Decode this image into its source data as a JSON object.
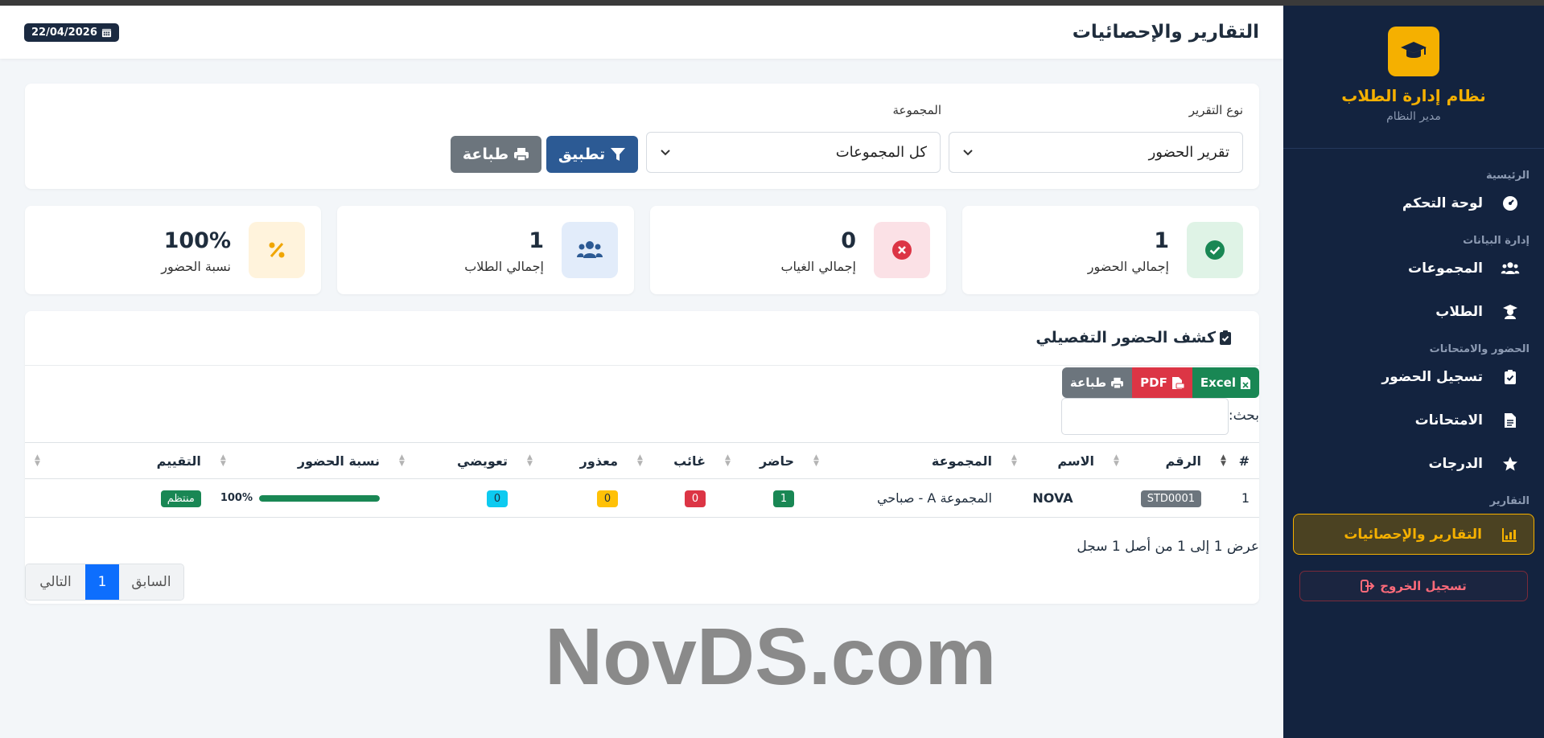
{
  "header": {
    "title": "التقارير والإحصائيات",
    "date": "22/04/2026"
  },
  "sidebar": {
    "brand_title": "نظام إدارة الطلاب",
    "brand_sub": "مدير النظام",
    "sections": {
      "main": "الرئيسية",
      "data": "إدارة البيانات",
      "attendance": "الحضور والامتحانات",
      "reports": "التقارير"
    },
    "items": {
      "dashboard": "لوحة التحكم",
      "groups": "المجموعات",
      "students": "الطلاب",
      "attendance": "تسجيل الحضور",
      "exams": "الامتحانات",
      "grades": "الدرجات",
      "reports": "التقارير والإحصائيات"
    },
    "logout": "تسجيل الخروج"
  },
  "filter": {
    "report_type_label": "نوع التقرير",
    "report_type_value": "تقرير الحضور",
    "group_label": "المجموعة",
    "group_value": "كل المجموعات",
    "apply": "تطبيق",
    "print": "طباعة"
  },
  "stats": [
    {
      "value": "1",
      "label": "إجمالي الحضور"
    },
    {
      "value": "0",
      "label": "إجمالي الغياب"
    },
    {
      "value": "1",
      "label": "إجمالي الطلاب"
    },
    {
      "value": "100%",
      "label": "نسبة الحضور"
    }
  ],
  "table_card": {
    "title": "كشف الحضور التفصيلي",
    "export": {
      "excel": "Excel",
      "pdf": "PDF",
      "print": "طباعة"
    },
    "search_label": "بحث:",
    "columns": [
      "#",
      "الرقم",
      "الاسم",
      "المجموعة",
      "حاضر",
      "غائب",
      "معذور",
      "تعويضي",
      "نسبة الحضور",
      "التقييم"
    ],
    "rows": [
      {
        "num": "1",
        "id": "STD0001",
        "name": "NOVA",
        "group": "المجموعة A - صباحي",
        "present": "1",
        "absent": "0",
        "excused": "0",
        "makeup": "0",
        "rate": "100%",
        "rate_fraction": 1.0,
        "grade": "منتظم"
      }
    ],
    "info": "عرض 1 إلى 1 من أصل 1 سجل",
    "pager": {
      "prev": "السابق",
      "page": "1",
      "next": "التالي"
    }
  },
  "watermark": "NovDS.com",
  "colors": {
    "sidebar_bg": "#13233f",
    "accent": "#f5b000",
    "primary": "#2c5a94",
    "success": "#198754",
    "danger": "#dc3545",
    "warning": "#ffc107",
    "info": "#0dcaf0",
    "secondary": "#6c757d"
  }
}
